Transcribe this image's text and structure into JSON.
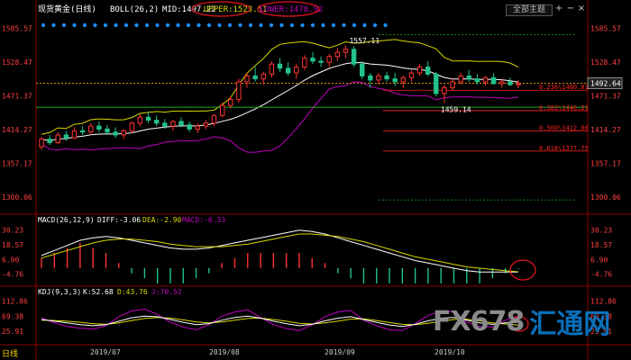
{
  "title": "现货黄金(日线)",
  "indicator_label": "BOLL(26,2)",
  "boll": {
    "mid": "MID:1497.22",
    "upper": "UPPER:1523.51",
    "lower": "LOWER:1470.92"
  },
  "main_scale": [
    "1585.57",
    "1528.47",
    "1471.37",
    "1414.27",
    "1357.17",
    "1300.06"
  ],
  "current_price_tag": "1492.64",
  "high_label": "1557.11",
  "low_label": "1459.14",
  "fib_levels": [
    {
      "label": "0.236\\1480.81",
      "value": 1480.81
    },
    {
      "label": "0.382\\1446.21",
      "value": 1446.21
    },
    {
      "label": "0.500\\1412.00",
      "value": 1412.0
    },
    {
      "label": "0.618\\1377.75",
      "value": 1377.75
    }
  ],
  "macd": {
    "header": "MACD(26,12,9)",
    "diff": "DIFF:-3.06",
    "dea": "DEA:-2.90",
    "macd": "MACD:-0.33",
    "scale": [
      "30.23",
      "18.57",
      "6.90",
      "-4.76"
    ]
  },
  "kdj": {
    "header": "KDJ(9,3,3)",
    "k": "K:52.68",
    "d": "D:43.76",
    "j": "J:70.52",
    "scale": [
      "112.86",
      "69.38",
      "25.91"
    ]
  },
  "x_labels": [
    "2019/07",
    "2019/08",
    "2019/09",
    "2019/10"
  ],
  "period": "日线",
  "dropdown": "全部主题",
  "watermark": {
    "text": "FX678",
    "cn": "汇通网"
  },
  "colors": {
    "up": "#ff3333",
    "down": "#22c28c",
    "mid": "#ffffff",
    "upper": "#d8d800",
    "lower": "#c000c0",
    "fib": "#ff2020",
    "support": "#22aa22",
    "price": "#ffa000"
  },
  "chart_data": {
    "type": "candlestick",
    "title": "现货黄金(日线)",
    "ylim": [
      1280,
      1600
    ],
    "x": [
      "2019/07",
      "2019/08",
      "2019/09",
      "2019/10"
    ],
    "candles": [
      [
        1385,
        1402,
        1380,
        1398
      ],
      [
        1398,
        1405,
        1388,
        1392
      ],
      [
        1392,
        1410,
        1390,
        1405
      ],
      [
        1405,
        1412,
        1395,
        1400
      ],
      [
        1400,
        1418,
        1398,
        1412
      ],
      [
        1412,
        1420,
        1405,
        1410
      ],
      [
        1410,
        1425,
        1405,
        1420
      ],
      [
        1420,
        1428,
        1410,
        1415
      ],
      [
        1415,
        1422,
        1405,
        1410
      ],
      [
        1410,
        1418,
        1400,
        1405
      ],
      [
        1405,
        1415,
        1398,
        1412
      ],
      [
        1412,
        1428,
        1408,
        1425
      ],
      [
        1425,
        1440,
        1420,
        1435
      ],
      [
        1435,
        1445,
        1425,
        1430
      ],
      [
        1430,
        1438,
        1420,
        1425
      ],
      [
        1425,
        1432,
        1415,
        1420
      ],
      [
        1420,
        1430,
        1412,
        1428
      ],
      [
        1428,
        1435,
        1418,
        1422
      ],
      [
        1422,
        1428,
        1410,
        1415
      ],
      [
        1415,
        1425,
        1408,
        1420
      ],
      [
        1420,
        1430,
        1415,
        1425
      ],
      [
        1425,
        1440,
        1420,
        1438
      ],
      [
        1438,
        1460,
        1435,
        1455
      ],
      [
        1455,
        1470,
        1450,
        1465
      ],
      [
        1465,
        1500,
        1460,
        1495
      ],
      [
        1495,
        1510,
        1485,
        1505
      ],
      [
        1505,
        1520,
        1495,
        1500
      ],
      [
        1500,
        1512,
        1490,
        1508
      ],
      [
        1508,
        1530,
        1502,
        1525
      ],
      [
        1525,
        1535,
        1512,
        1518
      ],
      [
        1518,
        1528,
        1505,
        1510
      ],
      [
        1510,
        1525,
        1500,
        1520
      ],
      [
        1520,
        1540,
        1515,
        1535
      ],
      [
        1535,
        1545,
        1525,
        1530
      ],
      [
        1530,
        1538,
        1520,
        1528
      ],
      [
        1528,
        1542,
        1520,
        1538
      ],
      [
        1538,
        1552,
        1530,
        1545
      ],
      [
        1545,
        1557,
        1535,
        1550
      ],
      [
        1550,
        1555,
        1520,
        1525
      ],
      [
        1525,
        1530,
        1500,
        1505
      ],
      [
        1505,
        1510,
        1485,
        1498
      ],
      [
        1498,
        1510,
        1490,
        1505
      ],
      [
        1505,
        1512,
        1495,
        1500
      ],
      [
        1500,
        1510,
        1488,
        1495
      ],
      [
        1495,
        1505,
        1485,
        1502
      ],
      [
        1502,
        1515,
        1495,
        1510
      ],
      [
        1510,
        1525,
        1505,
        1520
      ],
      [
        1520,
        1530,
        1505,
        1508
      ],
      [
        1508,
        1512,
        1470,
        1475
      ],
      [
        1475,
        1490,
        1459,
        1485
      ],
      [
        1485,
        1500,
        1480,
        1495
      ],
      [
        1495,
        1510,
        1490,
        1505
      ],
      [
        1505,
        1515,
        1495,
        1500
      ],
      [
        1500,
        1508,
        1490,
        1495
      ],
      [
        1495,
        1505,
        1488,
        1502
      ],
      [
        1502,
        1510,
        1490,
        1492
      ],
      [
        1492,
        1500,
        1485,
        1495
      ],
      [
        1495,
        1502,
        1488,
        1490
      ],
      [
        1490,
        1498,
        1484,
        1492
      ]
    ],
    "macd_series": {
      "diff": [
        10,
        14,
        18,
        22,
        24,
        25,
        24,
        22,
        20,
        18,
        16,
        15,
        15,
        16,
        18,
        20,
        22,
        24,
        26,
        28,
        30,
        29,
        27,
        24,
        21,
        18,
        15,
        12,
        9,
        6,
        4,
        2,
        0,
        -2,
        -3,
        -3,
        -3,
        -3.06
      ],
      "dea": [
        8,
        11,
        14,
        17,
        20,
        22,
        23,
        23,
        22,
        21,
        19,
        18,
        17,
        17,
        17,
        18,
        19,
        21,
        23,
        25,
        27,
        27,
        26,
        25,
        23,
        21,
        18,
        15,
        12,
        9,
        7,
        5,
        3,
        1,
        0,
        -1,
        -2,
        -2.9
      ]
    },
    "kdj_series": {
      "k": [
        60,
        55,
        50,
        45,
        42,
        45,
        55,
        65,
        70,
        68,
        60,
        52,
        45,
        48,
        58,
        66,
        70,
        64,
        55,
        48,
        42,
        46,
        56,
        64,
        68,
        60,
        52,
        44,
        40,
        46,
        56,
        64,
        66,
        58,
        50,
        46,
        50,
        52.68
      ],
      "d": [
        58,
        57,
        55,
        52,
        48,
        46,
        50,
        57,
        63,
        66,
        64,
        59,
        53,
        50,
        53,
        58,
        63,
        64,
        60,
        55,
        49,
        47,
        50,
        55,
        61,
        62,
        57,
        51,
        46,
        45,
        49,
        55,
        60,
        61,
        56,
        50,
        47,
        43.76
      ],
      "j": [
        65,
        50,
        40,
        35,
        32,
        42,
        68,
        85,
        90,
        75,
        52,
        38,
        30,
        45,
        70,
        82,
        88,
        66,
        45,
        34,
        28,
        44,
        68,
        82,
        86,
        58,
        42,
        30,
        28,
        48,
        72,
        84,
        82,
        52,
        40,
        38,
        58,
        70.52
      ]
    }
  }
}
